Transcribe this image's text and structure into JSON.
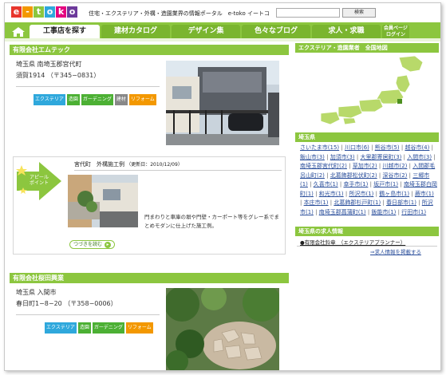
{
  "header": {
    "logo_letters": [
      "e",
      "-",
      "t",
      "o",
      "k",
      "o"
    ],
    "logo_colors": [
      "#e8362c",
      "#f39800",
      "#8cc63f",
      "#2fa8dc",
      "#e4007f",
      "#6d3a9b"
    ],
    "tagline": "住宅・エクステリア・外構・造園業界の情報ポータル　e-toko イートコ",
    "search_placeholder": "",
    "search_button": "検索"
  },
  "nav": {
    "home_icon": "home-icon",
    "tabs": [
      {
        "label": "工事店を探す",
        "active": true
      },
      {
        "label": "建材カタログ",
        "active": false
      },
      {
        "label": "デザイン集",
        "active": false
      },
      {
        "label": "色々なブログ",
        "active": false
      },
      {
        "label": "求人・求職",
        "active": false
      },
      {
        "label": "会員ページ\nログイン",
        "active": false
      }
    ]
  },
  "companies": [
    {
      "name": "有限会社エムテック",
      "address_line1": "埼玉県 南埼玉郡宮代町",
      "address_line2": "須賀1914 （〒345−0831）",
      "badges": [
        {
          "label": "エクステリア",
          "color": "#2fa8dc"
        },
        {
          "label": "造園",
          "color": "#4cb034"
        },
        {
          "label": "ガーデニング",
          "color": "#4cb034"
        },
        {
          "label": "建材",
          "color": "#888888"
        },
        {
          "label": "リフォーム",
          "color": "#f39800"
        }
      ]
    },
    {
      "name": "有限会社桜田興業",
      "address_line1": "埼玉県 入間市",
      "address_line2": "春日町1−8−20 （〒358−0006）",
      "badges": [
        {
          "label": "エクステリア",
          "color": "#2fa8dc"
        },
        {
          "label": "造園",
          "color": "#4cb034"
        },
        {
          "label": "ガーデニング",
          "color": "#4cb034"
        },
        {
          "label": "リフォーム",
          "color": "#f39800"
        }
      ]
    }
  ],
  "appeal": {
    "arrow_label": "アピール\nポイント",
    "post_title": "宮代町　外構施工例",
    "post_date": "（更新日：2010/12/09）",
    "post_body": "門まわりと車庫の塀や門壁・カーポート等をグレー系でまとめモダンに仕上げた施工例。",
    "read_more": "つづきを読む"
  },
  "sidebar": {
    "map_title": "エクステリア・造園業者　全国地図",
    "pref_title": "埼玉県",
    "cities": [
      "さいたま市(15)",
      "川口市(6)",
      "熊谷市(5)",
      "越谷市(4)",
      "飯山市(3)",
      "加須市(3)",
      "大里郡寄居町(3)",
      "入間市(3)",
      "南埼玉郡宮代町(2)",
      "草加市(2)",
      "川越市(2)",
      "入間郡毛呂山町(2)",
      "北葛飾郡松伏町(2)",
      "深谷市(2)",
      "三郷市(1)",
      "久喜市(1)",
      "幸手市(1)",
      "坂戸市(1)",
      "南埼玉郡白岡町(1)",
      "和光市(1)",
      "所沢市(1)",
      "鶴ヶ島市(1)",
      "蕨市(1)",
      "本庄市(1)",
      "北葛飾郡杉戸町(1)",
      "春日部市(1)",
      "所沢市(1)",
      "南埼玉郡菖蒲町(1)",
      "飯能市(1)",
      "行田市(1)"
    ],
    "jobs_title": "埼玉県の求人情報",
    "job_item": "●有限会社鈴章　（エクステリアプランナー）",
    "jobs_more": "⇒求人情報を掲載する"
  }
}
